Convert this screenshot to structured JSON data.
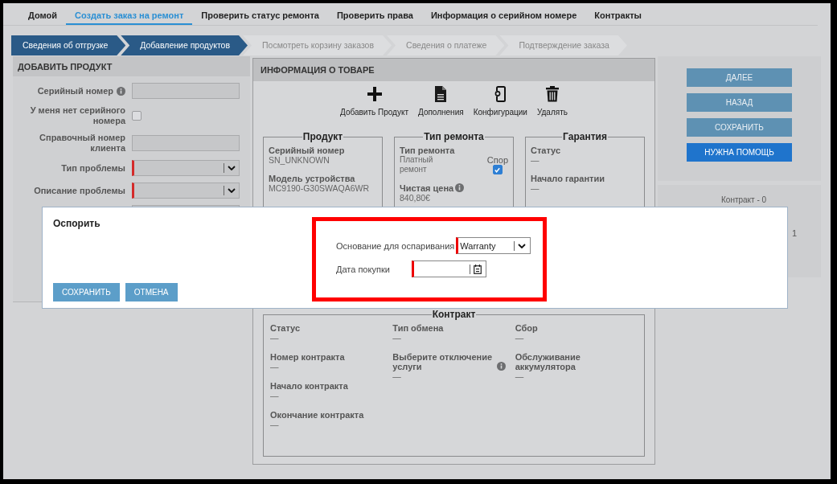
{
  "nav": {
    "tabs": [
      {
        "label": "Домой",
        "selected": false
      },
      {
        "label": "Создать заказ на ремонт",
        "selected": true
      },
      {
        "label": "Проверить статус ремонта",
        "selected": false
      },
      {
        "label": "Проверить права",
        "selected": false
      },
      {
        "label": "Информация о серийном номере",
        "selected": false
      },
      {
        "label": "Контракты",
        "selected": false
      }
    ]
  },
  "steps": [
    {
      "label": "Сведения об отгрузке",
      "completed": true
    },
    {
      "label": "Добавление продуктов",
      "completed": true
    },
    {
      "label": "Посмотреть корзину заказов",
      "completed": false
    },
    {
      "label": "Сведения о платеже",
      "completed": false
    },
    {
      "label": "Подтверждение заказа",
      "completed": false
    }
  ],
  "add_product": {
    "title": "ДОБАВИТЬ ПРОДУКТ",
    "fields": [
      {
        "kind": "text",
        "label": "Серийный номер",
        "info": true,
        "required": false
      },
      {
        "kind": "checkbox",
        "label": "У меня нет серийного номера",
        "checked": false
      },
      {
        "kind": "text",
        "label": "Справочный номер клиента",
        "info": false,
        "required": false
      },
      {
        "kind": "select",
        "label": "Тип проблемы",
        "info": false,
        "required": true
      },
      {
        "kind": "select",
        "label": "Описание проблемы",
        "info": false,
        "required": true
      }
    ]
  },
  "product_info": {
    "title": "ИНФОРМАЦИЯ О ТОВАРЕ",
    "actions": [
      {
        "kind": "add",
        "label": "Добавить Продукт"
      },
      {
        "kind": "document",
        "label": "Дополнения"
      },
      {
        "kind": "configure",
        "label": "Конфигурации"
      },
      {
        "kind": "delete",
        "label": "Удалять"
      }
    ],
    "sections": [
      {
        "title": "Продукт",
        "items": [
          {
            "label": "Серийный номер",
            "value": "SN_UNKNOWN",
            "info": false
          },
          {
            "label": "Модель устройства",
            "value": "MC9190-G30SWAQA6WR",
            "info": false
          }
        ]
      },
      {
        "title": "Тип ремонта",
        "items": [
          {
            "label": "Тип ремонта",
            "value": "Платный ремонт",
            "info": false
          },
          {
            "label": "Чистая цена",
            "value": "840,80€",
            "info": true
          }
        ],
        "dispute": {
          "label": "Спор",
          "checked": true
        }
      },
      {
        "title": "Гарантия",
        "items": [
          {
            "label": "Статус",
            "value": "—",
            "info": false
          },
          {
            "label": "Начало гарантии",
            "value": "—",
            "info": false
          }
        ]
      }
    ],
    "contract": {
      "title": "Контракт",
      "columns": [
        [
          {
            "label": "Статус",
            "value": "—",
            "info": false
          },
          {
            "label": "Номер контракта",
            "value": "—",
            "info": false
          },
          {
            "label": "Начало контракта",
            "value": "—",
            "info": false
          },
          {
            "label": "Окончание контракта",
            "value": "—",
            "info": false
          }
        ],
        [
          {
            "label": "Тип обмена",
            "value": "—",
            "info": false
          },
          {
            "label": "Выберите отключение услуги",
            "value": "—",
            "info": true
          }
        ],
        [
          {
            "label": "Сбор",
            "value": "—",
            "info": false
          },
          {
            "label": "Обслуживание аккумулятора",
            "value": "—",
            "info": false
          }
        ]
      ]
    }
  },
  "actions": [
    {
      "label": "ДАЛЕЕ",
      "kind": "secondary"
    },
    {
      "label": "НАЗАД",
      "kind": "secondary"
    },
    {
      "label": "СОХРАНИТЬ",
      "kind": "secondary"
    },
    {
      "label": "НУЖНА ПОМОЩЬ",
      "kind": "primary"
    }
  ],
  "contracts_card": {
    "title": "Контракт - 0",
    "column_2": "1"
  },
  "modal": {
    "title": "Оспорить",
    "highlighted": true,
    "fields": [
      {
        "kind": "select",
        "label": "Основание для оспаривания",
        "value": "Warranty",
        "required": true
      },
      {
        "kind": "date",
        "label": "Дата покупки",
        "required": true
      }
    ],
    "buttons": [
      "СОХРАНИТЬ",
      "ОТМЕНА"
    ]
  }
}
